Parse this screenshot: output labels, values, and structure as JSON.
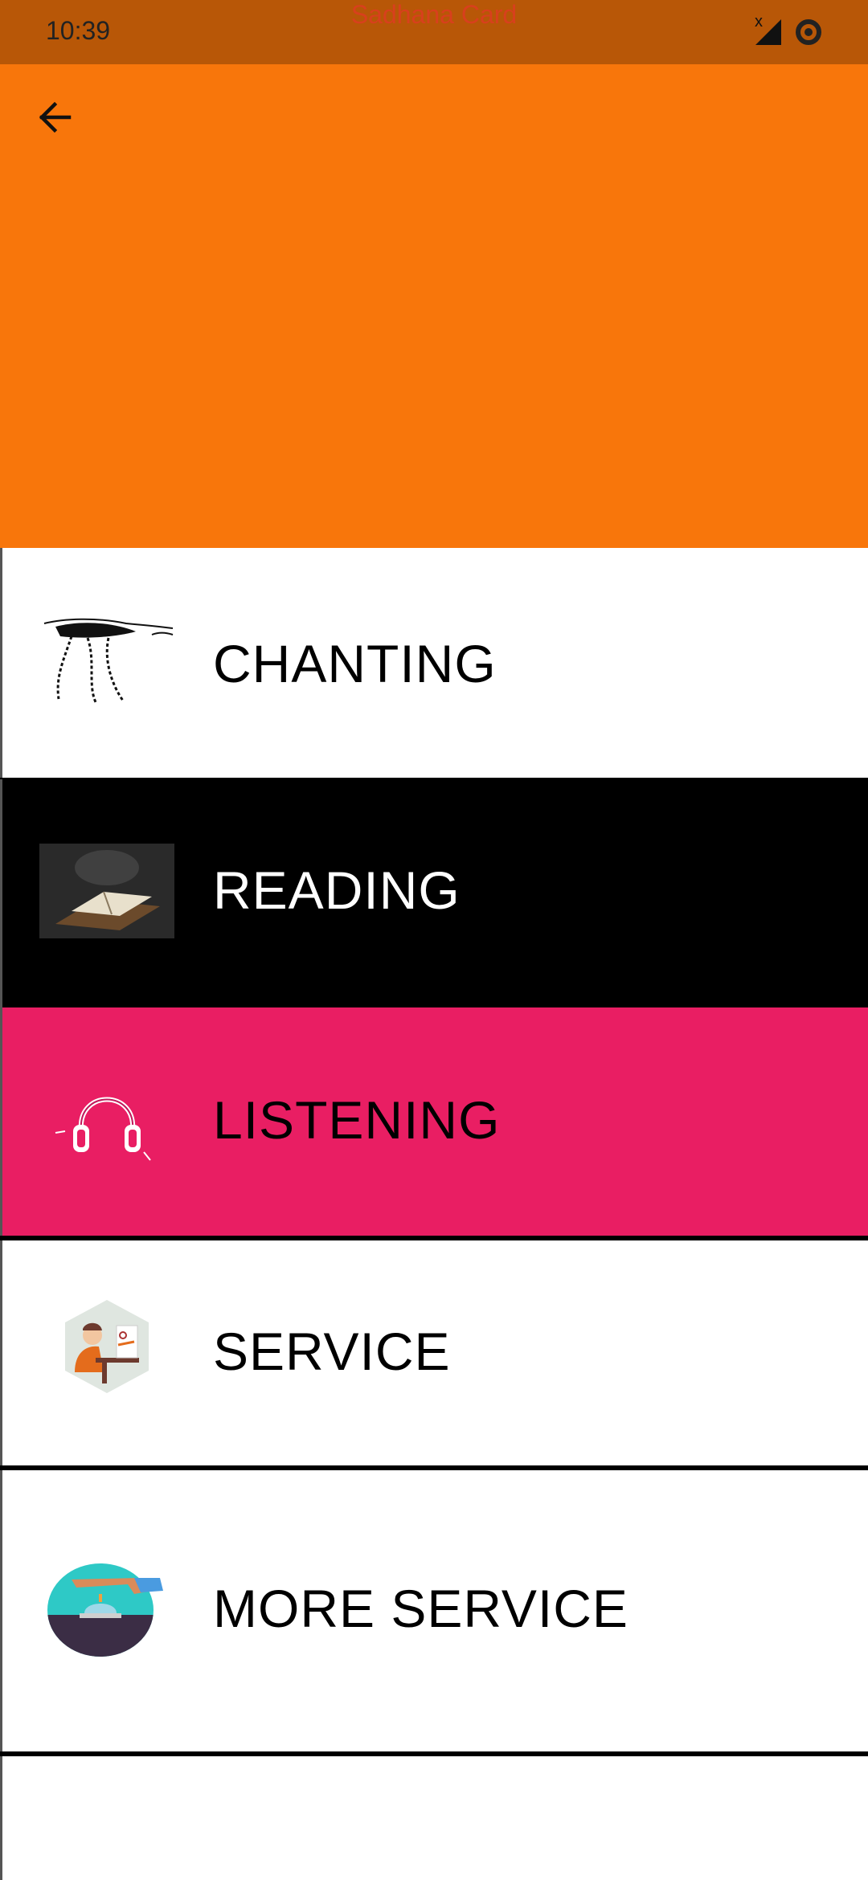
{
  "status_bar": {
    "time": "10:39",
    "app_title": "Sadhana Card",
    "x_mark": "x"
  },
  "header": {
    "background": "#f8760b",
    "back_icon": "arrow-left-icon"
  },
  "menu": {
    "items": [
      {
        "label": "CHANTING",
        "icon": "japa-beads-hand-icon",
        "background": "#ffffff",
        "text_color": "#000000"
      },
      {
        "label": "READING",
        "icon": "open-book-icon",
        "background": "#000000",
        "text_color": "#ffffff"
      },
      {
        "label": "LISTENING",
        "icon": "headphones-icon",
        "background": "#e91e63",
        "text_color": "#000000"
      },
      {
        "label": "SERVICE",
        "icon": "person-at-desk-icon",
        "background": "#ffffff",
        "text_color": "#000000"
      },
      {
        "label": "MORE SERVICE",
        "icon": "service-bell-icon",
        "background": "#ffffff",
        "text_color": "#000000"
      }
    ]
  }
}
